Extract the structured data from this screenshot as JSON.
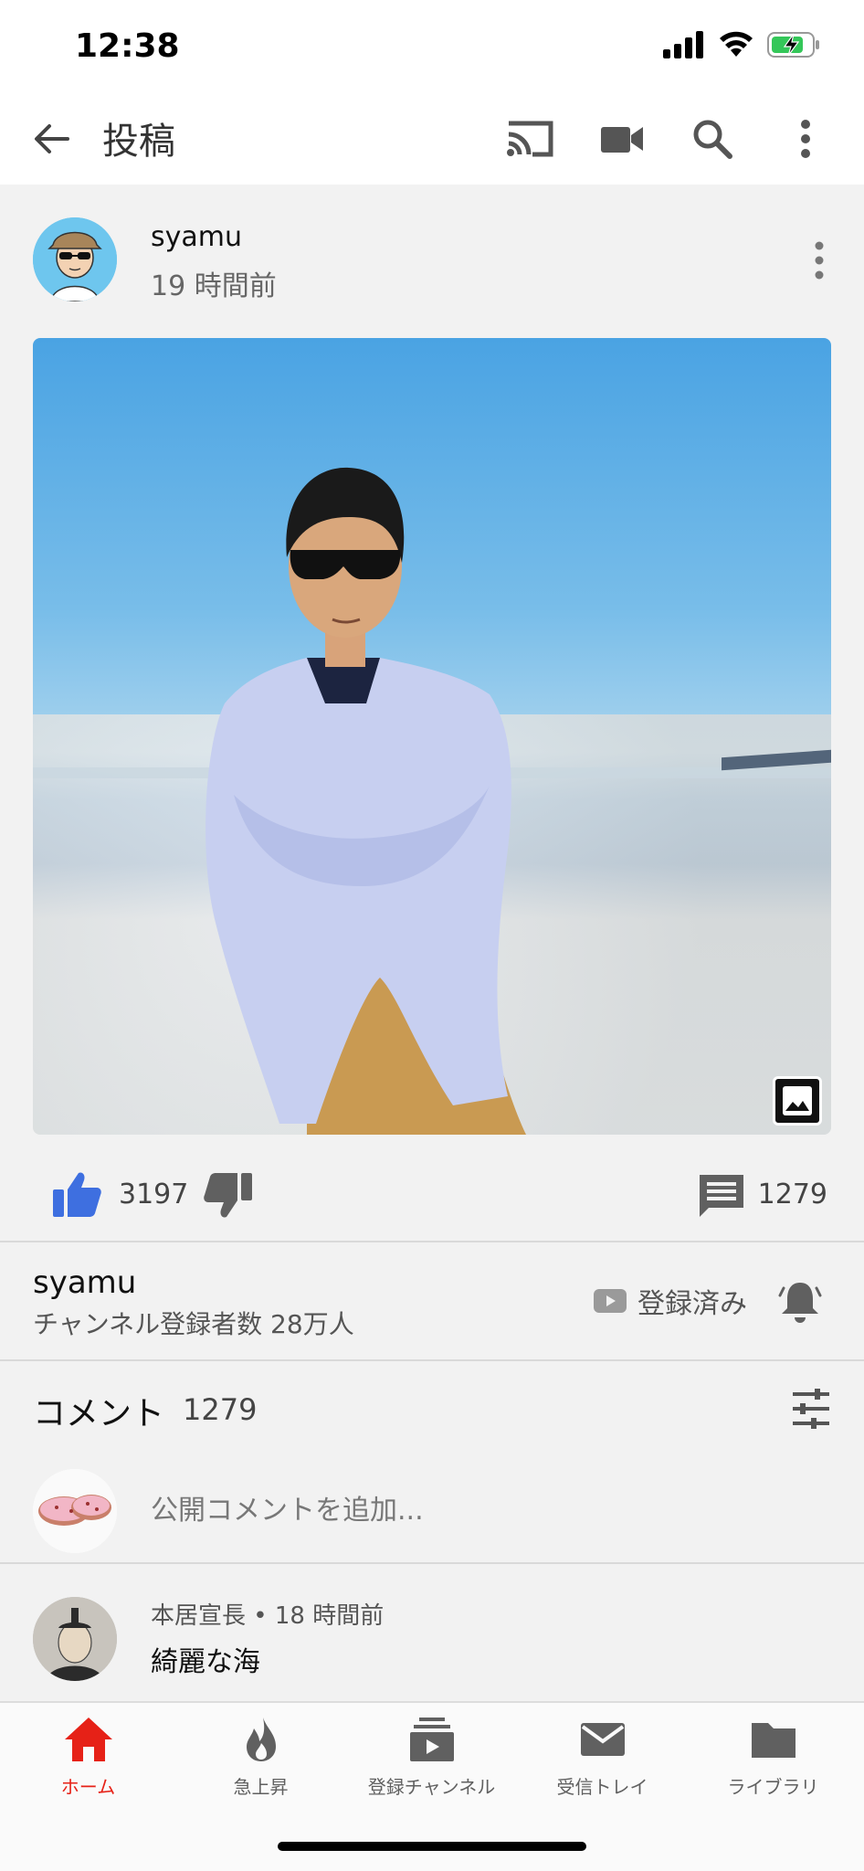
{
  "status_bar": {
    "time": "12:38"
  },
  "app_bar": {
    "title": "投稿"
  },
  "post": {
    "author": "syamu",
    "time_ago": "19 時間前",
    "likes": "3197",
    "comments_count": "1279"
  },
  "channel": {
    "name": "syamu",
    "subscribers": "チャンネル登録者数 28万人",
    "subscribe_status": "登録済み"
  },
  "comments": {
    "label": "コメント",
    "count": "1279",
    "add_placeholder": "公開コメントを追加...",
    "items": [
      {
        "author_time": "本居宣長 • 18 時間前",
        "text": "綺麗な海"
      }
    ]
  },
  "bottom_nav": {
    "items": [
      {
        "label": "ホーム",
        "icon": "home-icon",
        "active": true
      },
      {
        "label": "急上昇",
        "icon": "flame-icon",
        "active": false
      },
      {
        "label": "登録チャンネル",
        "icon": "subscriptions-icon",
        "active": false
      },
      {
        "label": "受信トレイ",
        "icon": "mail-icon",
        "active": false
      },
      {
        "label": "ライブラリ",
        "icon": "folder-icon",
        "active": false
      }
    ]
  },
  "colors": {
    "accent": "#e62117",
    "like_blue": "#3e6fe0",
    "icon_gray": "#606060"
  }
}
